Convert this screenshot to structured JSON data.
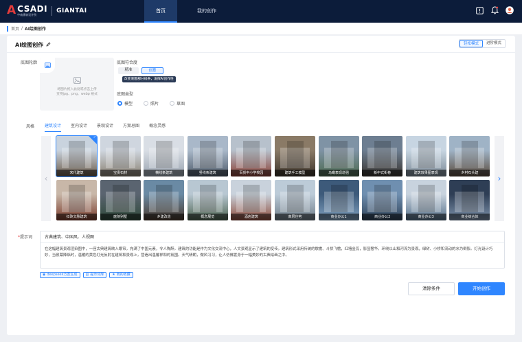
{
  "header": {
    "logo_mark": "A",
    "logo_main": "CSADI",
    "logo_sub": "中南建筑设计院",
    "brand": "GIANTAI",
    "nav": [
      {
        "label": "首页",
        "active": true
      },
      {
        "label": "我的创作",
        "active": false
      }
    ],
    "icons": [
      "alert-box-icon",
      "bell-icon",
      "user-avatar-icon"
    ]
  },
  "breadcrumb": {
    "home": "首页",
    "sep": "/",
    "current": "AI绘图创作"
  },
  "page": {
    "title": "AI绘图创作",
    "modes": [
      {
        "label": "轻松模式",
        "active": true
      },
      {
        "label": "进阶模式",
        "active": false
      }
    ]
  },
  "outline": {
    "label": "底图轮廓",
    "tip_line1": "将图片拖入此处或点击上传",
    "tip_line2": "支持jpg、png、webp 格式"
  },
  "fit": {
    "label": "底图符合度",
    "options": [
      {
        "label": "精准",
        "active": false
      },
      {
        "label": "创意",
        "active": true
      }
    ],
    "tooltip": "改变底图部分线条，发挥AI创作性"
  },
  "base_type": {
    "label": "底图类型",
    "options": [
      {
        "label": "模型",
        "checked": true
      },
      {
        "label": "照片",
        "checked": false
      },
      {
        "label": "草图",
        "checked": false
      }
    ]
  },
  "style": {
    "label": "风格",
    "tabs": [
      {
        "label": "建筑设计",
        "active": true
      },
      {
        "label": "室内设计",
        "active": false
      },
      {
        "label": "景观设计",
        "active": false
      },
      {
        "label": "方案总图",
        "active": false
      },
      {
        "label": "概念灵感",
        "active": false
      }
    ],
    "items": [
      {
        "label": "宋代建筑",
        "selected": true,
        "colors": [
          "#c9d3de",
          "#6b5a48"
        ]
      },
      {
        "label": "宝贵石材",
        "selected": false,
        "colors": [
          "#cfd6df",
          "#8a8172"
        ]
      },
      {
        "label": "横线条建筑",
        "selected": false,
        "colors": [
          "#d9dee5",
          "#9aa4b0"
        ]
      },
      {
        "label": "竖线条建筑",
        "selected": false,
        "colors": [
          "#a9b8c9",
          "#4e5b6a"
        ]
      },
      {
        "label": "百货中小学校园",
        "selected": false,
        "colors": [
          "#b7c1cc",
          "#8a3f35"
        ]
      },
      {
        "label": "建筑手工模型",
        "selected": false,
        "colors": [
          "#8a7a66",
          "#3d342b"
        ]
      },
      {
        "label": "乌瞰表现增强",
        "selected": false,
        "colors": [
          "#7f93a5",
          "#4c6a4f"
        ]
      },
      {
        "label": "新中式街巷",
        "selected": false,
        "colors": [
          "#6d7e91",
          "#3a3530"
        ]
      },
      {
        "label": "建筑效果图表现",
        "selected": false,
        "colors": [
          "#c7d5e2",
          "#7b8a96"
        ]
      },
      {
        "label": "乡村石头建",
        "selected": false,
        "colors": [
          "#9fb3c6",
          "#5a4a3c"
        ]
      },
      {
        "label": "红砖文脉建筑",
        "selected": false,
        "colors": [
          "#c8b7a8",
          "#7a3b2c"
        ]
      },
      {
        "label": "庭院别墅",
        "selected": false,
        "colors": [
          "#5a6470",
          "#2f4a3a"
        ]
      },
      {
        "label": "乡建改造",
        "selected": false,
        "colors": [
          "#6a8aa4",
          "#4b3a2d"
        ]
      },
      {
        "label": "概念展览",
        "selected": false,
        "colors": [
          "#b8c7d2",
          "#4d6450"
        ]
      },
      {
        "label": "酒店建筑",
        "selected": false,
        "colors": [
          "#c9d2dc",
          "#8e4c3c"
        ]
      },
      {
        "label": "高层住宅",
        "selected": false,
        "colors": [
          "#bccbd8",
          "#6f7c88"
        ]
      },
      {
        "label": "商业办公1",
        "selected": false,
        "colors": [
          "#3d5a7a",
          "#7fa0bf"
        ]
      },
      {
        "label": "商业办公2",
        "selected": false,
        "colors": [
          "#6f8fb0",
          "#2f4258"
        ]
      },
      {
        "label": "商业办公3",
        "selected": false,
        "colors": [
          "#c8d3de",
          "#55708a"
        ]
      },
      {
        "label": "商业综合体",
        "selected": false,
        "colors": [
          "#2e3e55",
          "#7d92ab"
        ]
      }
    ]
  },
  "prompt": {
    "label": "提示词",
    "required_mark": "*",
    "keywords": "古典建筑、中国风、人视图",
    "description": "在这幅建筑景观渲染图中，一座古典建筑映入眼帘，充满了中国元素，令人陶醉。建筑的功能是作为文化交流中心，人文景观显示了建筑的变传。建筑形式采用传统的歇檐、斗拱飞檐，红墙金瓦，影显奢华。环绕以山和河流为景观，绿树、小桥和流动的水为倒影。灯光设计巧妙，当夜幕降临时，温暖的黄色灯光反射在建筑和景观上，营造出温馨祥和的氛围。天气晴朗，微风习习，让人仿佛置身于一幅美妙的古典绘画之中。"
  },
  "tools": [
    {
      "label": "deepseek方案生成",
      "icon": "deepseek-icon"
    },
    {
      "label": "提示词库",
      "icon": "library-icon"
    },
    {
      "label": "我的收藏",
      "icon": "favorite-icon"
    }
  ],
  "actions": {
    "clear": "清除条件",
    "start": "开始创作"
  },
  "colors": {
    "accent": "#2f86ff",
    "topbar": "#0c1c3a",
    "brand_red": "#e23b3b"
  }
}
